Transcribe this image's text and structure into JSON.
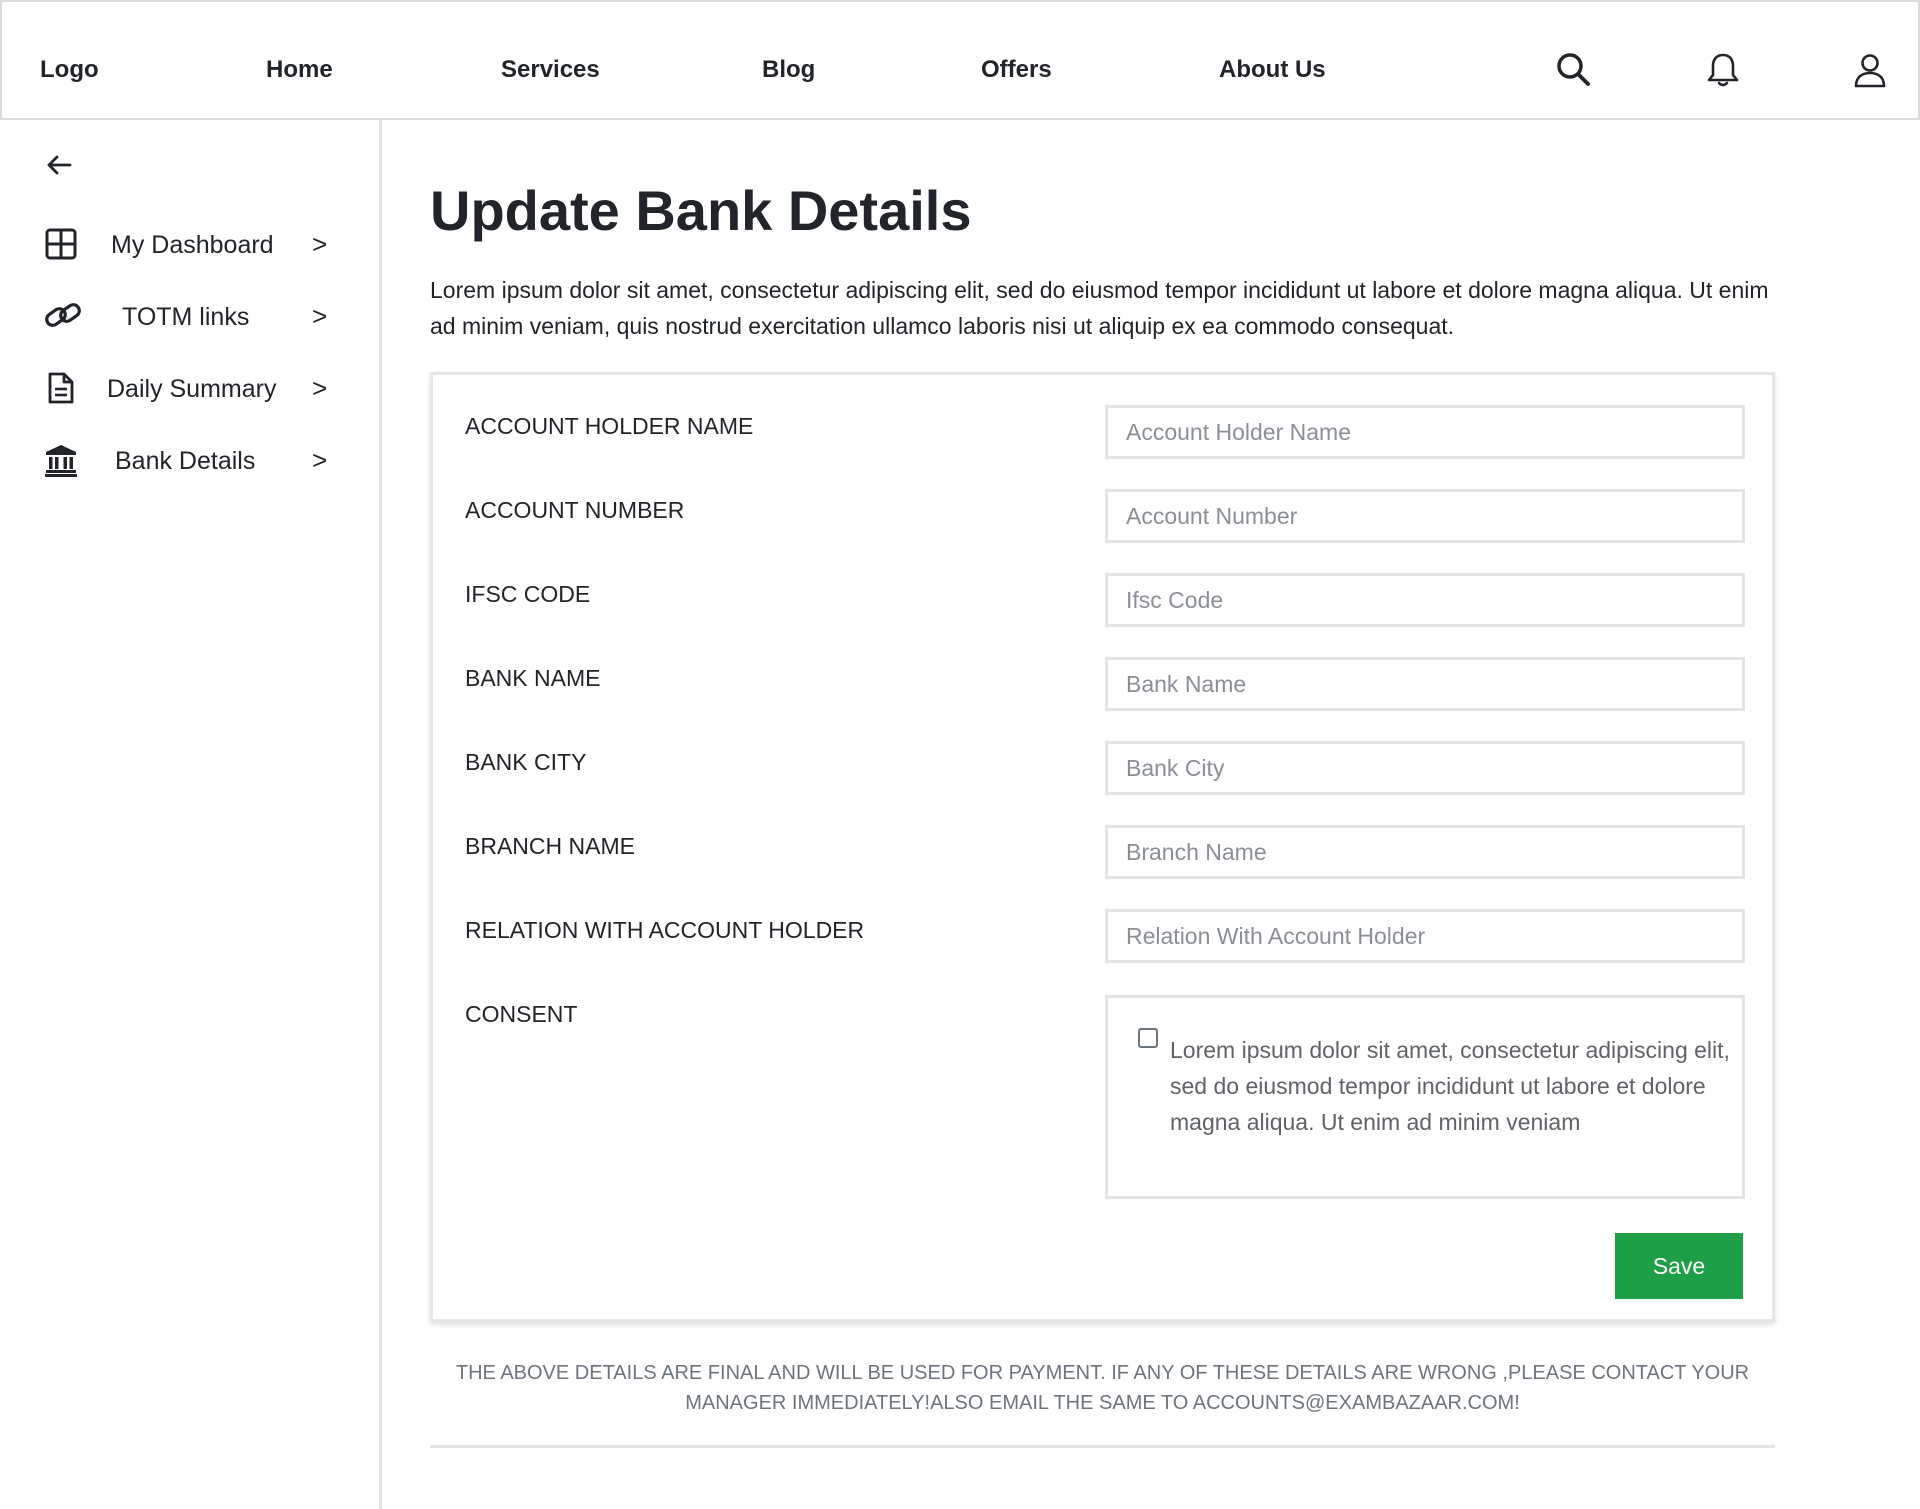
{
  "header": {
    "logo": "Logo",
    "nav": [
      "Home",
      "Services",
      "Blog",
      "Offers",
      "About Us"
    ],
    "icons": [
      "search-icon",
      "bell-icon",
      "user-icon"
    ]
  },
  "sidebar": {
    "back_icon": "arrow-left-icon",
    "chevron": ">",
    "items": [
      {
        "label": "My Dashboard",
        "icon": "dashboard-grid-icon"
      },
      {
        "label": "TOTM links",
        "icon": "link-icon"
      },
      {
        "label": "Daily Summary",
        "icon": "document-icon"
      },
      {
        "label": "Bank Details",
        "icon": "bank-icon"
      }
    ]
  },
  "main": {
    "title": "Update Bank Details",
    "intro": "Lorem ipsum dolor sit amet, consectetur adipiscing elit, sed do eiusmod tempor incididunt ut labore et dolore magna aliqua. Ut enim ad minim veniam, quis nostrud exercitation ullamco laboris nisi ut aliquip ex ea commodo consequat."
  },
  "form": {
    "fields": [
      {
        "label": "ACCOUNT HOLDER NAME",
        "placeholder": "Account Holder Name",
        "value": ""
      },
      {
        "label": "ACCOUNT NUMBER",
        "placeholder": "Account Number",
        "value": ""
      },
      {
        "label": "IFSC CODE",
        "placeholder": "Ifsc Code",
        "value": ""
      },
      {
        "label": "BANK NAME",
        "placeholder": "Bank Name",
        "value": ""
      },
      {
        "label": "BANK CITY",
        "placeholder": "Bank City",
        "value": ""
      },
      {
        "label": "BRANCH NAME",
        "placeholder": "Branch Name",
        "value": ""
      },
      {
        "label": "RELATION WITH ACCOUNT HOLDER",
        "placeholder": "Relation With Account Holder",
        "value": ""
      }
    ],
    "consent_label": "CONSENT",
    "consent_checked": false,
    "consent_text": "Lorem ipsum dolor sit amet, consectetur adipiscing elit, sed do eiusmod tempor incididunt ut labore et dolore magna aliqua. Ut enim ad minim veniam",
    "save_label": "Save"
  },
  "notice": "THE ABOVE DETAILS ARE FINAL AND WILL BE USED FOR PAYMENT. IF ANY OF THESE DETAILS ARE WRONG ,PLEASE CONTACT YOUR MANAGER IMMEDIATELY!ALSO EMAIL THE SAME TO ACCOUNTS@EXAMBAZAAR.COM!",
  "colors": {
    "accent": "#1e9e47",
    "text": "#212529",
    "border": "#e3e3e3",
    "muted": "#6c757d"
  }
}
